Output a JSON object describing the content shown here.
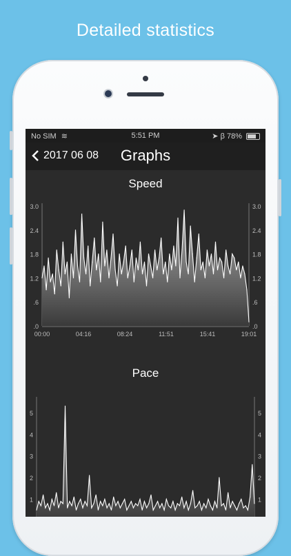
{
  "headline": "Detailed statistics",
  "status": {
    "carrier": "No SIM",
    "time": "5:51 PM",
    "battery": "78%"
  },
  "nav": {
    "back_label": "2017 06 08",
    "title": "Graphs"
  },
  "colors": {
    "background": "#6cc1e8",
    "screen": "#2b2b2b",
    "line": "#ffffff"
  },
  "chart_data": [
    {
      "type": "area",
      "title": "Speed",
      "ylim": [
        0,
        3.0
      ],
      "y_ticks": [
        "3.0",
        "2.4",
        "1.8",
        "1.2",
        ".6",
        ".0"
      ],
      "x_ticks": [
        "00:00",
        "04:16",
        "08:24",
        "11:51",
        "15:41",
        "19:01"
      ],
      "series": [
        {
          "values": [
            1.2,
            1.5,
            0.9,
            1.7,
            1.1,
            1.3,
            0.8,
            1.9,
            1.4,
            1.0,
            2.1,
            1.3,
            1.6,
            0.7,
            1.8,
            1.2,
            2.4,
            1.5,
            1.1,
            2.8,
            1.7,
            1.3,
            2.0,
            1.0,
            1.6,
            2.2,
            1.4,
            1.8,
            1.1,
            2.6,
            1.5,
            1.9,
            1.2,
            1.7,
            2.3,
            1.4,
            1.0,
            1.8,
            1.3,
            1.6,
            2.0,
            1.2,
            1.5,
            1.9,
            1.1,
            1.7,
            1.4,
            2.1,
            1.3,
            1.6,
            1.0,
            1.8,
            1.5,
            1.2,
            1.9,
            1.4,
            1.7,
            2.2,
            1.3,
            1.6,
            1.1,
            1.8,
            1.4,
            2.0,
            1.5,
            2.7,
            1.2,
            1.9,
            2.9,
            1.6,
            1.3,
            2.5,
            1.8,
            1.1,
            1.7,
            2.3,
            1.4,
            1.6,
            1.2,
            1.9,
            1.5,
            1.8,
            1.3,
            2.1,
            1.4,
            1.7,
            1.6,
            1.2,
            1.9,
            1.5,
            1.3,
            1.8,
            1.7,
            1.4,
            1.6,
            1.2,
            1.5,
            1.3,
            0.9,
            0.1
          ]
        }
      ]
    },
    {
      "type": "area",
      "title": "Pace",
      "y_ticks": [
        "5",
        "4",
        "3",
        "2",
        "1"
      ],
      "series": [
        {
          "values": [
            0.5,
            0.9,
            0.7,
            1.2,
            0.6,
            0.8,
            0.5,
            1.0,
            0.7,
            1.3,
            0.6,
            0.9,
            0.8,
            5.3,
            0.6,
            0.9,
            0.7,
            1.1,
            0.5,
            0.8,
            1.0,
            0.6,
            0.9,
            0.7,
            2.1,
            0.6,
            0.8,
            1.2,
            0.5,
            0.9,
            0.7,
            1.0,
            0.6,
            0.8,
            0.5,
            1.1,
            0.7,
            0.9,
            0.6,
            0.8,
            1.0,
            0.5,
            0.7,
            0.9,
            0.6,
            0.8,
            0.7,
            1.0,
            0.5,
            0.9,
            0.6,
            0.8,
            1.2,
            0.5,
            0.7,
            0.9,
            0.6,
            0.8,
            0.5,
            1.0,
            0.7,
            0.6,
            0.9,
            0.5,
            0.8,
            0.7,
            1.1,
            0.6,
            0.9,
            0.5,
            0.8,
            1.4,
            0.6,
            0.7,
            0.9,
            0.5,
            0.8,
            0.6,
            1.0,
            0.7,
            0.5,
            0.9,
            0.6,
            2.0,
            0.7,
            0.8,
            0.5,
            1.3,
            0.6,
            0.9,
            0.7,
            0.5,
            0.8,
            1.0,
            0.6,
            0.7,
            0.5,
            1.1,
            2.6,
            0.8
          ]
        }
      ]
    }
  ]
}
